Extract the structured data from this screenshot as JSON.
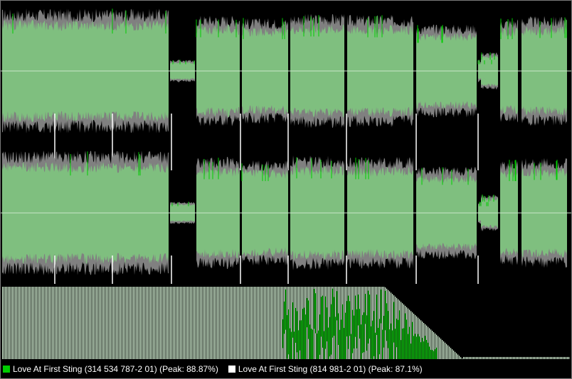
{
  "colors": {
    "background": "#000000",
    "track_a": "#00cc00",
    "track_b": "#ffffff",
    "envelope_fill": "#7fbf7f",
    "envelope_overlap_gray": "#808080",
    "spectrum_fill": "#d8f5d8",
    "spectrum_green": "#00c800",
    "centerline": "#c8e6c8"
  },
  "legend": {
    "items": [
      {
        "label": "Love At First Sting (314 534 787-2 01) (Peak: 88.87%)",
        "color": "#00cc00"
      },
      {
        "label": "Love At First Sting (814 981-2 01) (Peak: 87.1%)",
        "color": "#ffffff"
      }
    ]
  }
}
